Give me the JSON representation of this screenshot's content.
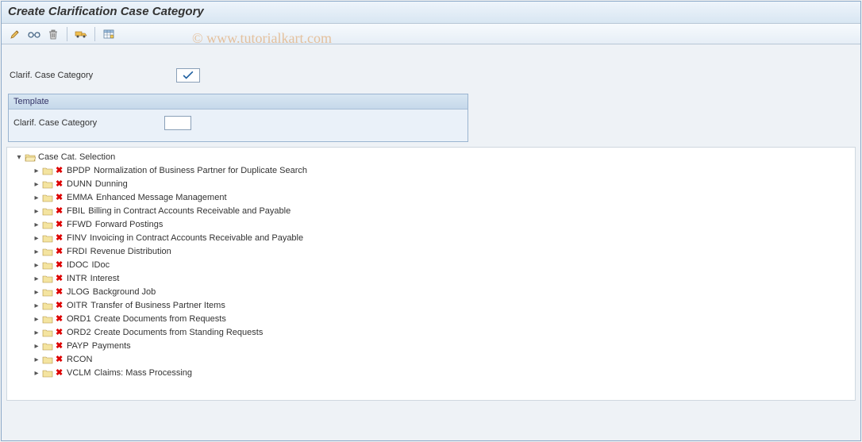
{
  "title": "Create Clarification Case Category",
  "watermark": "© www.tutorialkart.com",
  "toolbar": {
    "edit_icon": "pencil-icon",
    "display_icon": "glasses-icon",
    "delete_icon": "trash-icon",
    "transport_icon": "truck-icon",
    "table_icon": "table-icon"
  },
  "field1": {
    "label": "Clarif. Case Category",
    "value": ""
  },
  "panel": {
    "title": "Template",
    "field": {
      "label": "Clarif. Case Category",
      "value": ""
    }
  },
  "tree": {
    "root_label": "Case Cat. Selection",
    "items": [
      {
        "code": "BPDP",
        "desc": "Normalization of Business Partner for Duplicate Search"
      },
      {
        "code": "DUNN",
        "desc": "Dunning"
      },
      {
        "code": "EMMA",
        "desc": "Enhanced Message Management"
      },
      {
        "code": "FBIL",
        "desc": "Billing in Contract Accounts Receivable and Payable"
      },
      {
        "code": "FFWD",
        "desc": "Forward Postings"
      },
      {
        "code": "FINV",
        "desc": "Invoicing in Contract Accounts Receivable and Payable"
      },
      {
        "code": "FRDI",
        "desc": "Revenue Distribution"
      },
      {
        "code": "IDOC",
        "desc": "IDoc"
      },
      {
        "code": "INTR",
        "desc": "Interest"
      },
      {
        "code": "JLOG",
        "desc": "Background Job"
      },
      {
        "code": "OITR",
        "desc": "Transfer of Business Partner Items"
      },
      {
        "code": "ORD1",
        "desc": "Create Documents from Requests"
      },
      {
        "code": "ORD2",
        "desc": "Create Documents from Standing Requests"
      },
      {
        "code": "PAYP",
        "desc": "Payments"
      },
      {
        "code": "RCON",
        "desc": ""
      },
      {
        "code": "VCLM",
        "desc": "Claims: Mass Processing"
      }
    ]
  }
}
